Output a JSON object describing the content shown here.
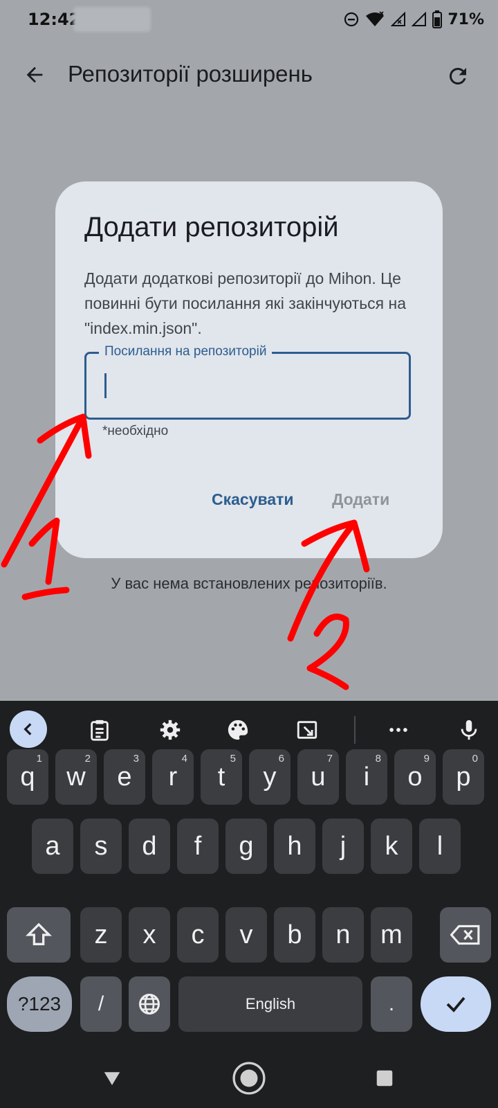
{
  "status_bar": {
    "time": "12:42",
    "battery": "71%"
  },
  "app_bar": {
    "title": "Репозиторії розширень",
    "back_icon": "arrow-back-icon",
    "refresh_icon": "refresh-icon"
  },
  "empty_message": "У вас нема встановлених репозиторіїв.",
  "dialog": {
    "title": "Додати репозиторій",
    "text": "Додати додаткові репозиторії до Mihon. Це повинні бути посилання які закінчуються на \"index.min.json\".",
    "field_label": "Посилання на репозиторій",
    "field_value": "",
    "helper": "*необхідно",
    "cancel_label": "Скасувати",
    "confirm_label": "Додати"
  },
  "annotations": [
    "1",
    "2"
  ],
  "keyboard": {
    "row1": [
      {
        "k": "q",
        "h": "1"
      },
      {
        "k": "w",
        "h": "2"
      },
      {
        "k": "e",
        "h": "3"
      },
      {
        "k": "r",
        "h": "4"
      },
      {
        "k": "t",
        "h": "5"
      },
      {
        "k": "y",
        "h": "6"
      },
      {
        "k": "u",
        "h": "7"
      },
      {
        "k": "i",
        "h": "8"
      },
      {
        "k": "o",
        "h": "9"
      },
      {
        "k": "p",
        "h": "0"
      }
    ],
    "row2": [
      "a",
      "s",
      "d",
      "f",
      "g",
      "h",
      "j",
      "k",
      "l"
    ],
    "row3": [
      "z",
      "x",
      "c",
      "v",
      "b",
      "n",
      "m"
    ],
    "symbols_label": "?123",
    "slash_label": "/",
    "space_label": "English",
    "period_label": "."
  },
  "colors": {
    "accent": "#2c5d8e",
    "dialog_bg": "#e1e5ec",
    "scrim": "#a3a7ac",
    "keyboard_bg": "#1e1f21",
    "annotation": "#ff0000"
  }
}
